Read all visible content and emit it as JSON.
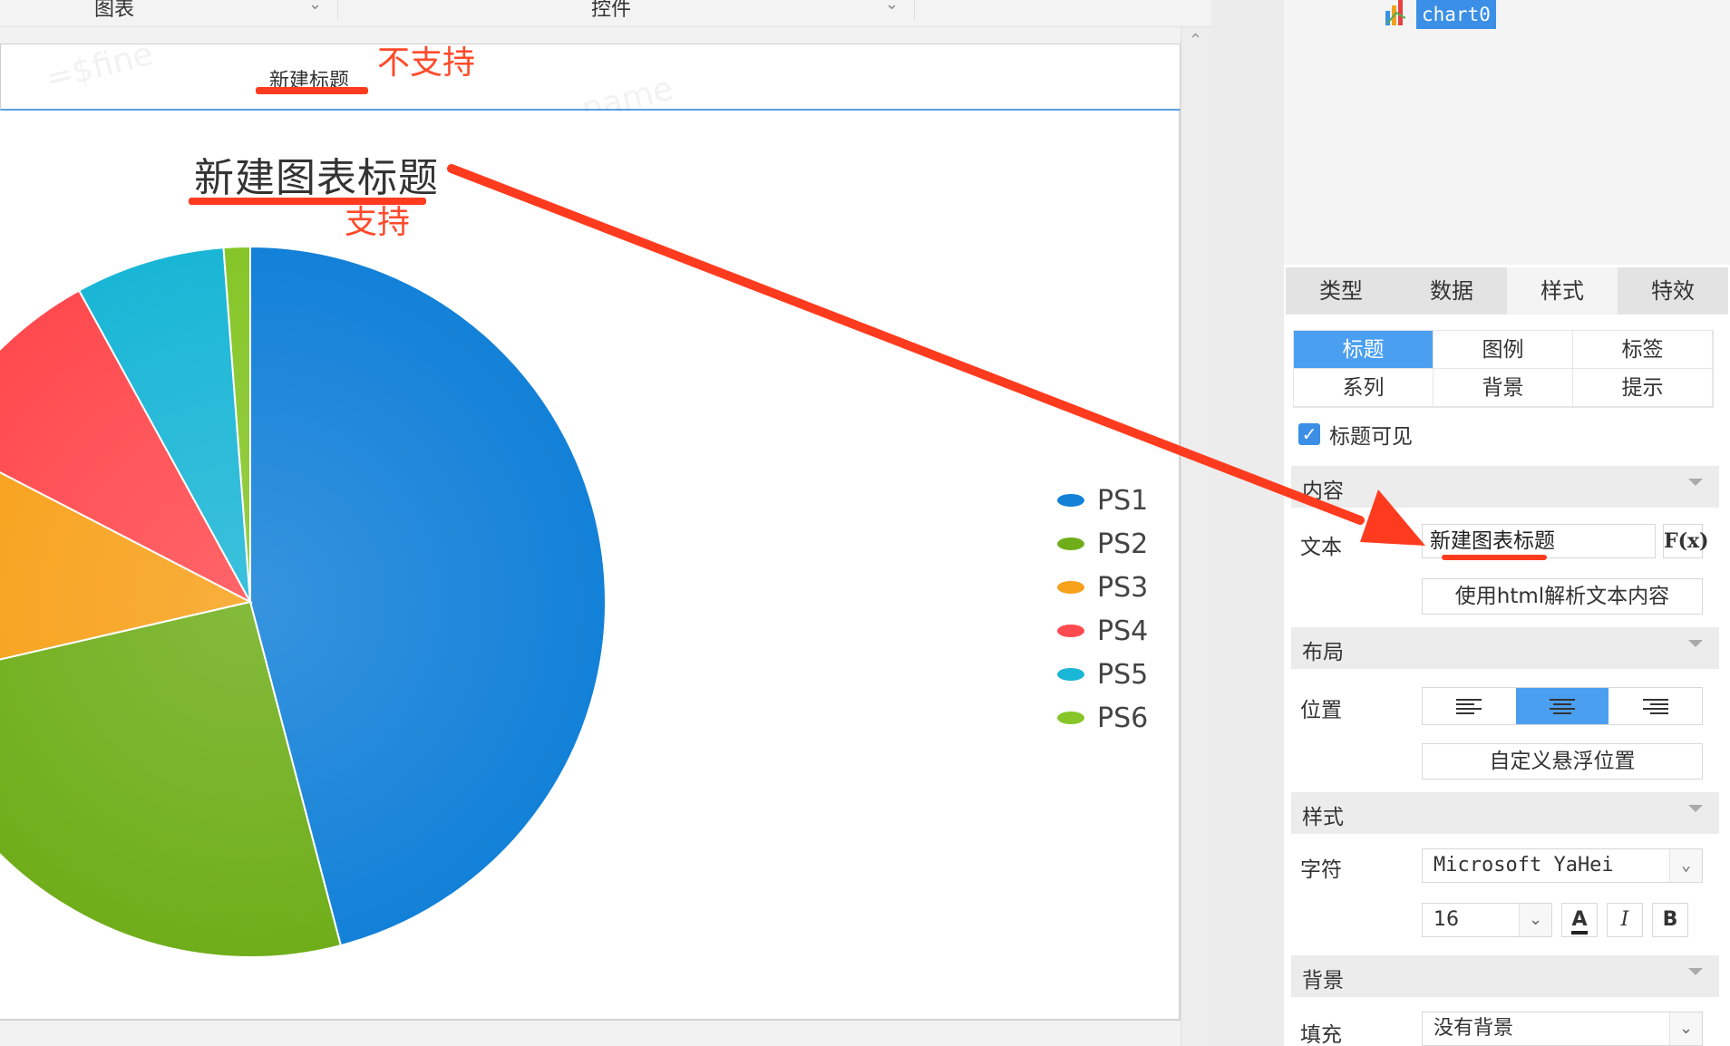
{
  "toolbar": {
    "item1": "图表",
    "item2": "控件"
  },
  "canvas": {
    "title_widget_text": "新建标题",
    "chart_title": "新建图表标题"
  },
  "chart_data": {
    "type": "pie",
    "title": "新建图表标题",
    "legend_position": "right",
    "series": [
      {
        "name": "PS1",
        "value": 45.9,
        "color": "#1381d8"
      },
      {
        "name": "PS2",
        "value": 25.5,
        "color": "#6fae1a"
      },
      {
        "name": "PS3",
        "value": 11.2,
        "color": "#f7a11a"
      },
      {
        "name": "PS4",
        "value": 9.4,
        "color": "#ff4a4f"
      },
      {
        "name": "PS5",
        "value": 6.8,
        "color": "#1ab6d6"
      },
      {
        "name": "PS6",
        "value": 1.2,
        "color": "#86c628"
      }
    ]
  },
  "annotations": {
    "not_supported": "不支持",
    "supported": "支持"
  },
  "panel": {
    "tree_node": "chart0",
    "main_tabs": [
      "类型",
      "数据",
      "样式",
      "特效"
    ],
    "active_main_tab": "样式",
    "sub_tabs": [
      "标题",
      "图例",
      "标签",
      "系列",
      "背景",
      "提示"
    ],
    "active_sub_tab": "标题",
    "title_visible_label": "标题可见",
    "section_content": "内容",
    "text_label": "文本",
    "text_value": "新建图表标题",
    "fx_label": "F(x)",
    "html_button": "使用html解析文本内容",
    "section_layout": "布局",
    "position_label": "位置",
    "custom_position_button": "自定义悬浮位置",
    "section_style": "样式",
    "font_label": "字符",
    "font_value": "Microsoft YaHei",
    "size_value": "16",
    "bold_label": "B",
    "italic_label": "I",
    "color_label": "A",
    "section_background": "背景",
    "fill_label": "填充",
    "fill_value": "没有背景"
  }
}
